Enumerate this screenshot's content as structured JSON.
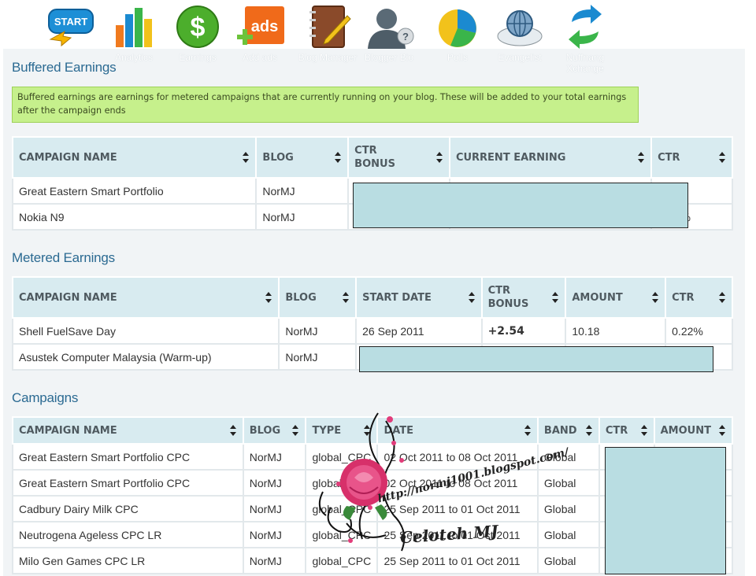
{
  "nav": {
    "items": [
      {
        "label": "",
        "icon": "start-icon"
      },
      {
        "label": "Analytics",
        "icon": "bar-chart-icon"
      },
      {
        "label": "Earnings",
        "icon": "dollar-icon"
      },
      {
        "label": "Add ads",
        "icon": "add-ads-icon"
      },
      {
        "label": "Blog Manager",
        "icon": "notebook-pencil-icon"
      },
      {
        "label": "Blogger Bio",
        "icon": "user-question-icon"
      },
      {
        "label": "Polls",
        "icon": "pie-chart-icon"
      },
      {
        "label": "Evangelist",
        "icon": "globe-cloud-icon"
      },
      {
        "label": "Nuffnang Xchange",
        "icon": "exchange-arrows-icon"
      }
    ],
    "start_text": "START",
    "ads_text": "ads"
  },
  "buffered": {
    "title": "Buffered Earnings",
    "info": "Buffered earnings are earnings for metered campaigns that are currently running on your blog. These will be added to your total earnings after the campaign ends",
    "headers": [
      "CAMPAIGN NAME",
      "BLOG",
      "CTR BONUS",
      "CURRENT EARNING",
      "CTR"
    ],
    "rows": [
      [
        "Great Eastern Smart Portfolio",
        "NorMJ"
      ],
      [
        "Nokia N9",
        "NorMJ"
      ]
    ],
    "partial": "%"
  },
  "metered": {
    "title": "Metered Earnings",
    "headers": [
      "CAMPAIGN NAME",
      "BLOG",
      "START DATE",
      "CTR BONUS",
      "AMOUNT",
      "CTR"
    ],
    "rows": [
      [
        "Shell FuelSave Day",
        "NorMJ",
        "26 Sep 2011",
        "+2.54",
        "10.18",
        "0.22%"
      ],
      [
        "Asustek Computer Malaysia (Warm-up)",
        "NorMJ"
      ]
    ]
  },
  "campaigns": {
    "title": "Campaigns",
    "headers": [
      "CAMPAIGN NAME",
      "BLOG",
      "TYPE",
      "DATE",
      "BAND",
      "CTR",
      "AMOUNT"
    ],
    "rows": [
      [
        "Great Eastern Smart Portfolio CPC",
        "NorMJ",
        "global_CPC",
        "02 Oct 2011 to 08 Oct 2011",
        "Global"
      ],
      [
        "Great Eastern Smart Portfolio CPC",
        "NorMJ",
        "global_CPC",
        "02 Oct 2011 to 08 Oct 2011",
        "Global"
      ],
      [
        "Cadbury Dairy Milk CPC",
        "NorMJ",
        "global_CPC",
        "25 Sep 2011 to 01 Oct 2011",
        "Global"
      ],
      [
        "Neutrogena Ageless CPC LR",
        "NorMJ",
        "global_CPC",
        "25 Sep 2011 to 01 Oct 2011",
        "Global"
      ],
      [
        "Milo Gen Games CPC LR",
        "NorMJ",
        "global_CPC",
        "25 Sep 2011 to 01 Oct 2011",
        "Global"
      ]
    ]
  },
  "watermark": {
    "url": "http://normj1001.blogspot.com/",
    "signature": "Celoteh MJ"
  },
  "colors": {
    "accent": "#2b6a92",
    "header_bg": "#d8ebf0",
    "info_bg": "#c6f08c",
    "redact": "#b9dde2",
    "positive": "#1f7a1f"
  }
}
